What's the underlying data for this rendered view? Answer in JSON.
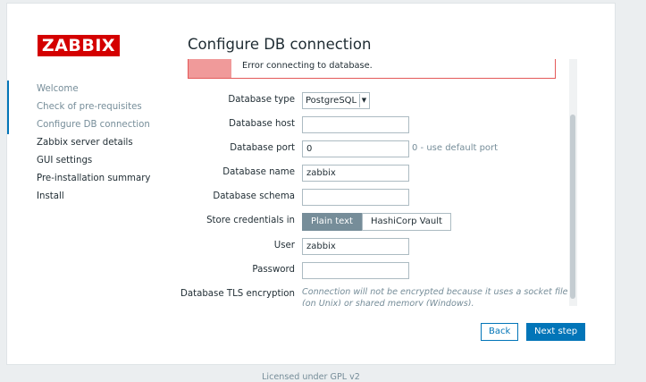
{
  "logo": "ZABBIX",
  "page_title": "Configure DB connection",
  "steps": [
    {
      "label": "Welcome",
      "status": "done"
    },
    {
      "label": "Check of pre-requisites",
      "status": "done"
    },
    {
      "label": "Configure DB connection",
      "status": "done"
    },
    {
      "label": "Zabbix server details",
      "status": "pending"
    },
    {
      "label": "GUI settings",
      "status": "pending"
    },
    {
      "label": "Pre-installation summary",
      "status": "pending"
    },
    {
      "label": "Install",
      "status": "pending"
    }
  ],
  "error": {
    "message": "Error connecting to database."
  },
  "form": {
    "db_type": {
      "label": "Database type",
      "value": "PostgreSQL"
    },
    "db_host": {
      "label": "Database host",
      "value": ""
    },
    "db_port": {
      "label": "Database port",
      "value": "0",
      "hint": "0 - use default port"
    },
    "db_name": {
      "label": "Database name",
      "value": "zabbix"
    },
    "db_schema": {
      "label": "Database schema",
      "value": ""
    },
    "store_credentials": {
      "label": "Store credentials in",
      "options": [
        "Plain text",
        "HashiCorp Vault"
      ],
      "selected": "Plain text"
    },
    "user": {
      "label": "User",
      "value": "zabbix"
    },
    "password": {
      "label": "Password",
      "value": ""
    },
    "tls": {
      "label": "Database TLS encryption",
      "note": "Connection will not be encrypted because it uses a socket file (on Unix) or shared memory (Windows)."
    }
  },
  "buttons": {
    "back": "Back",
    "next": "Next step"
  },
  "footer": "Licensed under GPL v2",
  "colors": {
    "brand": "#d40000",
    "accent": "#0275b8",
    "error": "#e45959"
  }
}
